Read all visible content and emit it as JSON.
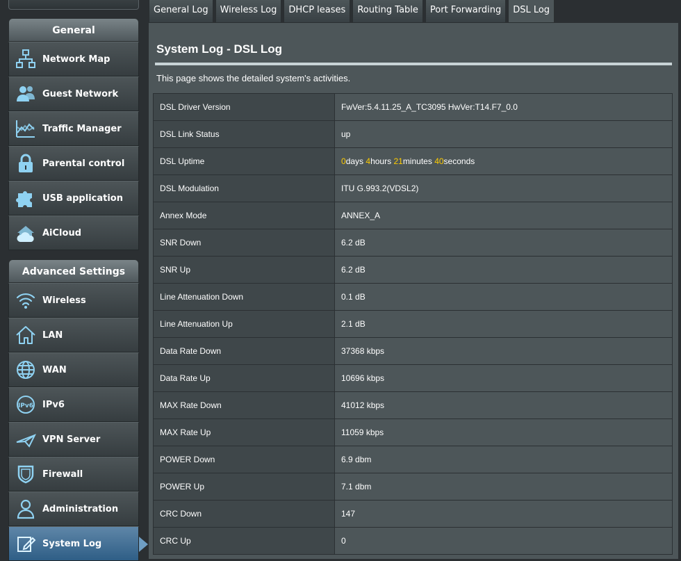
{
  "sidebar": {
    "general_title": "General",
    "general_items": [
      {
        "label": "Network Map",
        "icon": "network-map-icon"
      },
      {
        "label": "Guest Network",
        "icon": "guest-network-icon"
      },
      {
        "label": "Traffic Manager",
        "icon": "traffic-manager-icon"
      },
      {
        "label": "Parental control",
        "icon": "lock-icon"
      },
      {
        "label": "USB application",
        "icon": "puzzle-icon"
      },
      {
        "label": "AiCloud",
        "icon": "cloud-house-icon"
      }
    ],
    "advanced_title": "Advanced Settings",
    "advanced_items": [
      {
        "label": "Wireless",
        "icon": "wifi-icon"
      },
      {
        "label": "LAN",
        "icon": "house-icon"
      },
      {
        "label": "WAN",
        "icon": "globe-icon"
      },
      {
        "label": "IPv6",
        "icon": "ipv6-icon"
      },
      {
        "label": "VPN Server",
        "icon": "vpn-icon"
      },
      {
        "label": "Firewall",
        "icon": "shield-icon"
      },
      {
        "label": "Administration",
        "icon": "user-icon"
      },
      {
        "label": "System Log",
        "icon": "log-edit-icon",
        "active": true
      }
    ]
  },
  "tabs": [
    {
      "label": "General Log"
    },
    {
      "label": "Wireless Log"
    },
    {
      "label": "DHCP leases"
    },
    {
      "label": "Routing Table"
    },
    {
      "label": "Port Forwarding"
    },
    {
      "label": "DSL Log",
      "active": true
    }
  ],
  "main": {
    "title": "System Log - DSL Log",
    "description": "This page shows the detailed system's activities.",
    "uptime": {
      "days": "0",
      "days_unit": "days",
      "hours": "4",
      "hours_unit": "hours",
      "minutes": "21",
      "minutes_unit": "minutes",
      "seconds": "40",
      "seconds_unit": "seconds"
    },
    "rows": [
      {
        "key": "DSL Driver Version",
        "value": "FwVer:5.4.11.25_A_TC3095 HwVer:T14.F7_0.0"
      },
      {
        "key": "DSL Link Status",
        "value": "up"
      },
      {
        "key": "DSL Uptime",
        "value": ""
      },
      {
        "key": "DSL Modulation",
        "value": "ITU G.993.2(VDSL2)"
      },
      {
        "key": "Annex Mode",
        "value": "ANNEX_A"
      },
      {
        "key": "SNR Down",
        "value": "6.2 dB"
      },
      {
        "key": "SNR Up",
        "value": "6.2 dB"
      },
      {
        "key": "Line Attenuation Down",
        "value": "0.1 dB"
      },
      {
        "key": "Line Attenuation Up",
        "value": "2.1 dB"
      },
      {
        "key": "Data Rate Down",
        "value": "37368 kbps"
      },
      {
        "key": "Data Rate Up",
        "value": "10696 kbps"
      },
      {
        "key": "MAX Rate Down",
        "value": "41012 kbps"
      },
      {
        "key": "MAX Rate Up",
        "value": "11059 kbps"
      },
      {
        "key": "POWER Down",
        "value": "6.9 dbm"
      },
      {
        "key": "POWER Up",
        "value": "7.1 dbm"
      },
      {
        "key": "CRC Down",
        "value": "147"
      },
      {
        "key": "CRC Up",
        "value": "0"
      }
    ]
  },
  "colors": {
    "accent": "#ffcc00",
    "active": "#2f5e86",
    "panel": "#4d5659"
  }
}
